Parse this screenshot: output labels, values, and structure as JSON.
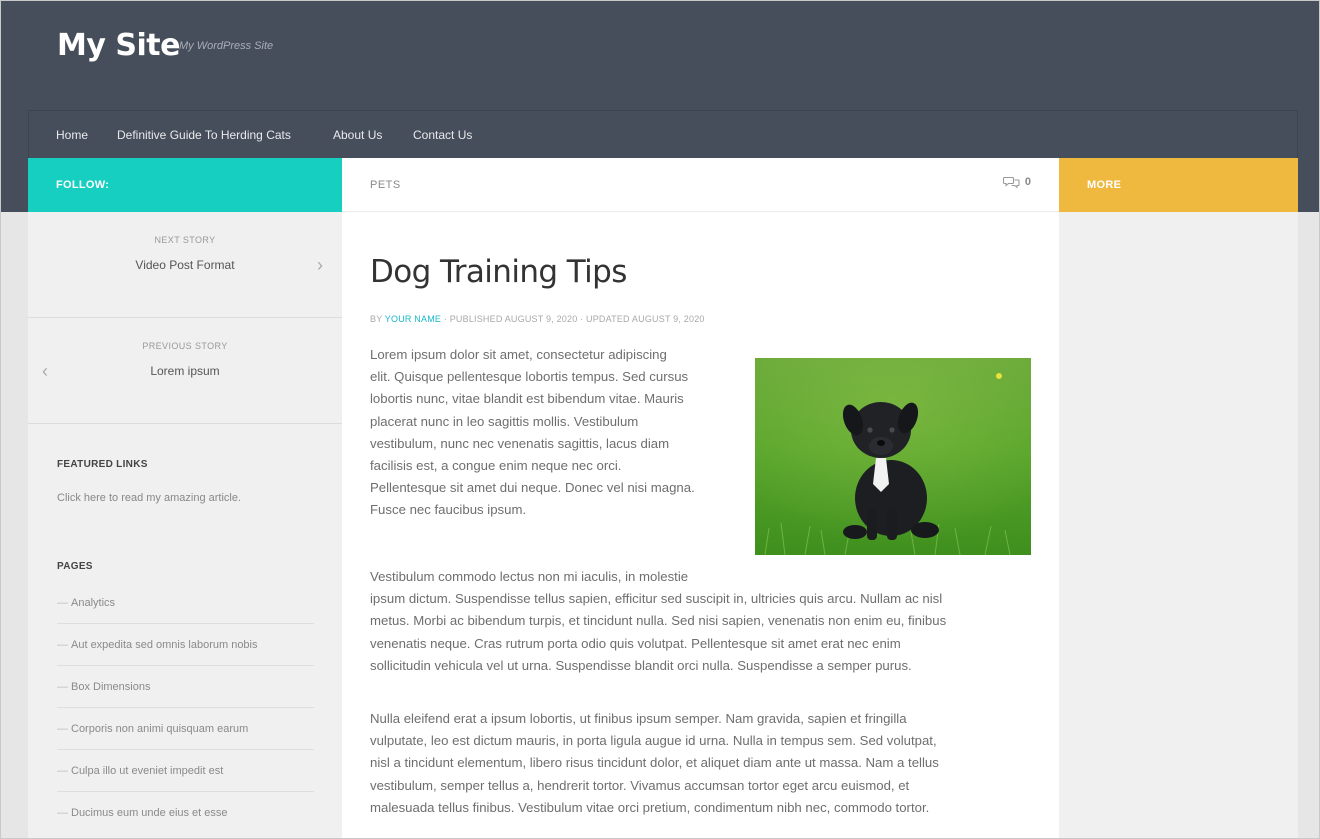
{
  "site": {
    "title": "My Site",
    "tagline": "My WordPress Site"
  },
  "nav": {
    "items": [
      "Home",
      "Definitive Guide To Herding Cats",
      "About Us",
      "Contact Us"
    ]
  },
  "follow_bar": {
    "label": "FOLLOW:"
  },
  "more_bar": {
    "label": "MORE"
  },
  "category_bar": {
    "category": "PETS",
    "comment_icon": "speech-bubbles-icon",
    "comment_count": "0"
  },
  "story_nav": {
    "next": {
      "kicker": "NEXT STORY",
      "title": "Video Post Format",
      "arrow": "›"
    },
    "previous": {
      "kicker": "PREVIOUS STORY",
      "title": "Lorem ipsum",
      "arrow": "‹"
    }
  },
  "featured_links": {
    "title": "FEATURED LINKS",
    "link_text": "Click here to read my amazing article."
  },
  "pages": {
    "title": "PAGES",
    "items": [
      "Analytics",
      "Aut expedita sed omnis laborum nobis",
      "Box Dimensions",
      "Corporis non animi quisquam earum",
      "Culpa illo ut eveniet impedit est",
      "Ducimus eum unde eius et esse"
    ]
  },
  "post": {
    "title": "Dog Training Tips",
    "meta_by": "BY",
    "author": "YOUR NAME",
    "meta_dates": "· PUBLISHED AUGUST 9, 2020 · UPDATED AUGUST 9, 2020",
    "paragraph1_lines": [
      "Lorem ipsum dolor sit amet, consectetur adipiscing",
      "elit. Quisque pellentesque lobortis tempus. Sed cursus",
      "lobortis nunc, vitae blandit est bibendum vitae. Mauris",
      "placerat nunc in leo sagittis mollis. Vestibulum",
      "vestibulum, nunc nec venenatis sagittis, lacus diam",
      "facilisis est, a congue enim neque nec orci.",
      "Pellentesque sit amet dui neque. Donec vel nisi magna.",
      "Fusce nec faucibus ipsum."
    ],
    "paragraph2_lines": [
      "Vestibulum commodo lectus non mi iaculis, in molestie",
      "ipsum dictum. Suspendisse tellus sapien, efficitur sed suscipit in, ultricies quis arcu. Nullam ac nisl",
      "metus. Morbi ac bibendum turpis, et tincidunt nulla. Sed nisi sapien, venenatis non enim eu, finibus",
      "venenatis neque. Cras rutrum porta odio quis volutpat. Pellentesque sit amet erat nec enim",
      "sollicitudin vehicula vel ut urna. Suspendisse blandit orci nulla. Suspendisse a semper purus."
    ],
    "paragraph3_lines": [
      "Nulla eleifend erat a ipsum lobortis, ut finibus ipsum semper. Nam gravida, sapien et fringilla",
      "vulputate, leo est dictum mauris, in porta ligula augue id urna. Nulla in tempus sem. Sed volutpat,",
      "nisl a tincidunt elementum, libero risus tincidunt dolor, et aliquet diam ante ut massa. Nam a tellus",
      "vestibulum, semper tellus a, hendrerit tortor. Vivamus accumsan tortor eget arcu euismod, et",
      "malesuada tellus finibus. Vestibulum vitae orci pretium, condimentum nibh nec, commodo tortor."
    ],
    "image_subject": "black-puppy-on-grass"
  },
  "colors": {
    "header_bg": "#474e5b",
    "follow_teal": "#16cfc1",
    "more_orange": "#efb93f",
    "link_teal": "#16b8c9"
  }
}
